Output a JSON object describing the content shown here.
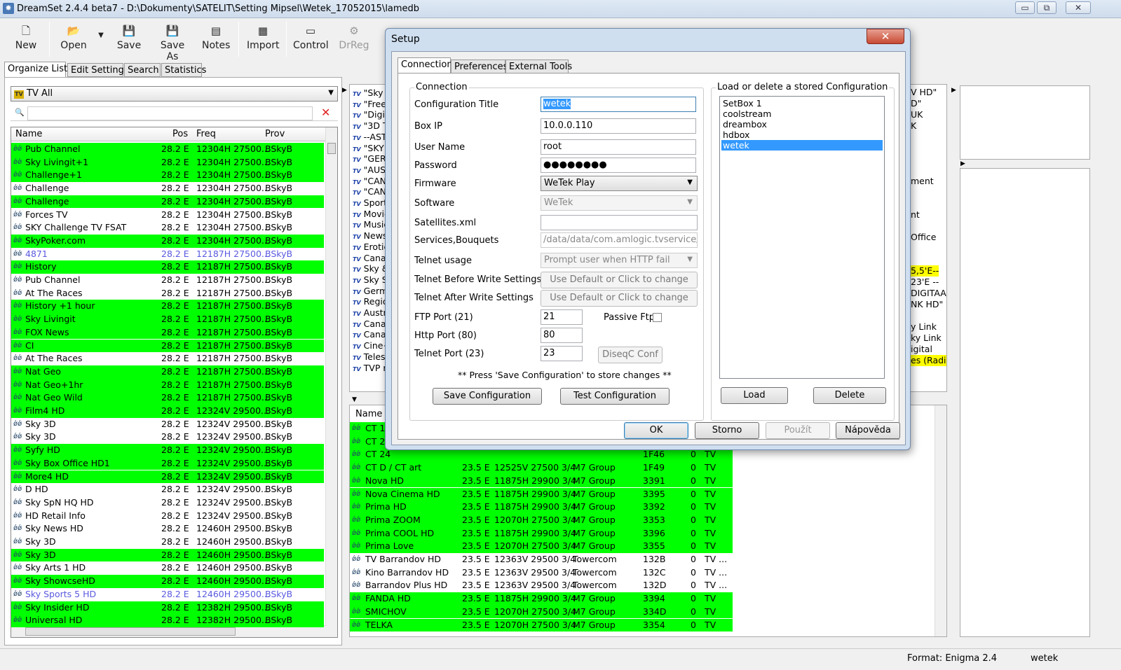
{
  "window": {
    "title": "DreamSet 2.4.4 beta7 - D:\\Dokumenty\\SATELIT\\Setting Mipsel\\Wetek_17052015\\lamedb",
    "min": "▭",
    "max": "⧉",
    "close": "✕"
  },
  "toolbar": {
    "new": "New",
    "open": "Open",
    "save": "Save",
    "save_as": "Save As",
    "notes": "Notes",
    "import": "Import",
    "control": "Control",
    "drreg": "DrReg"
  },
  "left_tabs": [
    "Organize Lists",
    "Edit Settings",
    "Search",
    "Statistics"
  ],
  "bouquet": "TV All",
  "list_headers": {
    "name": "Name",
    "pos": "Pos",
    "freq": "Freq",
    "prov": "Prov"
  },
  "channels": [
    {
      "name": "Pub Channel",
      "pos": "28.2 E",
      "freq": "12304H 27500...",
      "prov": "BSkyB",
      "style": "g"
    },
    {
      "name": "Sky Livingit+1",
      "pos": "28.2 E",
      "freq": "12304H 27500...",
      "prov": "BSkyB",
      "style": "g"
    },
    {
      "name": "Challenge+1",
      "pos": "28.2 E",
      "freq": "12304H 27500...",
      "prov": "BSkyB",
      "style": "g"
    },
    {
      "name": "Challenge",
      "pos": "28.2 E",
      "freq": "12304H 27500...",
      "prov": "BSkyB",
      "style": ""
    },
    {
      "name": "Challenge",
      "pos": "28.2 E",
      "freq": "12304H 27500...",
      "prov": "BSkyB",
      "style": "g"
    },
    {
      "name": "Forces TV",
      "pos": "28.2 E",
      "freq": "12304H 27500...",
      "prov": "BSkyB",
      "style": ""
    },
    {
      "name": "SKY Challenge TV FSAT",
      "pos": "28.2 E",
      "freq": "12304H 27500...",
      "prov": "BSkyB",
      "style": ""
    },
    {
      "name": "SkyPoker.com",
      "pos": "28.2 E",
      "freq": "12304H 27500...",
      "prov": "BSkyB",
      "style": "g"
    },
    {
      "name": "4871",
      "pos": "28.2 E",
      "freq": "12187H 27500...",
      "prov": "BSkyB",
      "style": "b"
    },
    {
      "name": "History",
      "pos": "28.2 E",
      "freq": "12187H 27500...",
      "prov": "BSkyB",
      "style": "g"
    },
    {
      "name": "Pub Channel",
      "pos": "28.2 E",
      "freq": "12187H 27500...",
      "prov": "BSkyB",
      "style": ""
    },
    {
      "name": "At The Races",
      "pos": "28.2 E",
      "freq": "12187H 27500...",
      "prov": "BSkyB",
      "style": ""
    },
    {
      "name": "History +1 hour",
      "pos": "28.2 E",
      "freq": "12187H 27500...",
      "prov": "BSkyB",
      "style": "g"
    },
    {
      "name": "Sky Livingit",
      "pos": "28.2 E",
      "freq": "12187H 27500...",
      "prov": "BSkyB",
      "style": "g"
    },
    {
      "name": "FOX News",
      "pos": "28.2 E",
      "freq": "12187H 27500...",
      "prov": "BSkyB",
      "style": "g"
    },
    {
      "name": "CI",
      "pos": "28.2 E",
      "freq": "12187H 27500...",
      "prov": "BSkyB",
      "style": "g"
    },
    {
      "name": "At The Races",
      "pos": "28.2 E",
      "freq": "12187H 27500...",
      "prov": "BSkyB",
      "style": ""
    },
    {
      "name": "Nat Geo",
      "pos": "28.2 E",
      "freq": "12187H 27500...",
      "prov": "BSkyB",
      "style": "g"
    },
    {
      "name": "Nat Geo+1hr",
      "pos": "28.2 E",
      "freq": "12187H 27500...",
      "prov": "BSkyB",
      "style": "g"
    },
    {
      "name": "Nat Geo Wild",
      "pos": "28.2 E",
      "freq": "12187H 27500...",
      "prov": "BSkyB",
      "style": "g"
    },
    {
      "name": "Film4 HD",
      "pos": "28.2 E",
      "freq": "12324V 29500...",
      "prov": "BSkyB",
      "style": "g"
    },
    {
      "name": "Sky 3D",
      "pos": "28.2 E",
      "freq": "12324V 29500...",
      "prov": "BSkyB",
      "style": ""
    },
    {
      "name": "Sky 3D",
      "pos": "28.2 E",
      "freq": "12324V 29500...",
      "prov": "BSkyB",
      "style": ""
    },
    {
      "name": "Syfy HD",
      "pos": "28.2 E",
      "freq": "12324V 29500...",
      "prov": "BSkyB",
      "style": "g"
    },
    {
      "name": "Sky Box Office HD1",
      "pos": "28.2 E",
      "freq": "12324V 29500...",
      "prov": "BSkyB",
      "style": "g"
    },
    {
      "name": "More4 HD",
      "pos": "28.2 E",
      "freq": "12324V 29500...",
      "prov": "BSkyB",
      "style": "g"
    },
    {
      "name": "D HD",
      "pos": "28.2 E",
      "freq": "12324V 29500...",
      "prov": "BSkyB",
      "style": ""
    },
    {
      "name": "Sky SpN HQ HD",
      "pos": "28.2 E",
      "freq": "12324V 29500...",
      "prov": "BSkyB",
      "style": ""
    },
    {
      "name": "HD Retail Info",
      "pos": "28.2 E",
      "freq": "12324V 29500...",
      "prov": "BSkyB",
      "style": ""
    },
    {
      "name": "Sky News HD",
      "pos": "28.2 E",
      "freq": "12460H 29500...",
      "prov": "BSkyB",
      "style": ""
    },
    {
      "name": "Sky 3D",
      "pos": "28.2 E",
      "freq": "12460H 29500...",
      "prov": "BSkyB",
      "style": ""
    },
    {
      "name": "Sky 3D",
      "pos": "28.2 E",
      "freq": "12460H 29500...",
      "prov": "BSkyB",
      "style": "g"
    },
    {
      "name": "Sky Arts 1 HD",
      "pos": "28.2 E",
      "freq": "12460H 29500...",
      "prov": "BSkyB",
      "style": ""
    },
    {
      "name": "Sky ShowcseHD",
      "pos": "28.2 E",
      "freq": "12460H 29500...",
      "prov": "BSkyB",
      "style": "g"
    },
    {
      "name": "Sky Sports 5 HD",
      "pos": "28.2 E",
      "freq": "12460H 29500...",
      "prov": "BSkyB",
      "style": "b"
    },
    {
      "name": "Sky Insider HD",
      "pos": "28.2 E",
      "freq": "12382H 29500...",
      "prov": "BSkyB",
      "style": "g"
    },
    {
      "name": "Universal HD",
      "pos": "28.2 E",
      "freq": "12382H 29500...",
      "prov": "BSkyB",
      "style": "g"
    }
  ],
  "bouquets_mid": [
    "\"Sky",
    "\"Free",
    "\"Digi",
    "\"3D T",
    "--AST",
    "\"SKY",
    "\"GER",
    "\"AUS",
    "\"CAN",
    "\"CAN",
    "Sport",
    "Movie",
    "Music",
    "News",
    "Erotic",
    "Canal",
    "Sky &",
    "Sky S",
    "Germ",
    "Regio",
    "Austri",
    "Canal",
    "Canal",
    "Cine+",
    "Teles",
    "TVP r"
  ],
  "right_fragments": [
    "V HD\"",
    "D\"",
    "UK",
    "K",
    "ment",
    "nt",
    "Office",
    "5,5'E--",
    "23'E --",
    "DIGITAA",
    "NK HD\"",
    "y Link",
    "ky Link",
    "igital",
    "es (Radic"
  ],
  "bottom_header": "Name",
  "bottom_rows": [
    {
      "name": "CT 1",
      "pos": "",
      "freq": "",
      "prov": "",
      "sid": "",
      "n": "",
      "type": "",
      "style": "g"
    },
    {
      "name": "CT 2",
      "pos": "",
      "freq": "",
      "prov": "",
      "sid": "",
      "n": "",
      "type": "",
      "style": "g"
    },
    {
      "name": "CT 24",
      "pos": "",
      "freq": "",
      "prov": "",
      "sid": "1F46",
      "n": "0",
      "type": "TV",
      "style": "g"
    },
    {
      "name": "CT D / CT art",
      "pos": "23.5 E",
      "freq": "12525V 27500 3/4",
      "prov": "M7 Group",
      "sid": "1F49",
      "n": "0",
      "type": "TV",
      "style": "g"
    },
    {
      "name": "Nova HD",
      "pos": "23.5 E",
      "freq": "11875H 29900 3/4",
      "prov": "M7 Group",
      "sid": "3391",
      "n": "0",
      "type": "TV",
      "style": "g"
    },
    {
      "name": "Nova Cinema HD",
      "pos": "23.5 E",
      "freq": "11875H 29900 3/4",
      "prov": "M7 Group",
      "sid": "3395",
      "n": "0",
      "type": "TV",
      "style": "g"
    },
    {
      "name": "Prima HD",
      "pos": "23.5 E",
      "freq": "11875H 29900 3/4",
      "prov": "M7 Group",
      "sid": "3392",
      "n": "0",
      "type": "TV",
      "style": "g"
    },
    {
      "name": "Prima ZOOM",
      "pos": "23.5 E",
      "freq": "12070H 27500 3/4",
      "prov": "M7 Group",
      "sid": "3353",
      "n": "0",
      "type": "TV",
      "style": "g"
    },
    {
      "name": "Prima COOL HD",
      "pos": "23.5 E",
      "freq": "11875H 29900 3/4",
      "prov": "M7 Group",
      "sid": "3396",
      "n": "0",
      "type": "TV",
      "style": "g"
    },
    {
      "name": "Prima Love",
      "pos": "23.5 E",
      "freq": "12070H 27500 3/4",
      "prov": "M7 Group",
      "sid": "3355",
      "n": "0",
      "type": "TV",
      "style": "g"
    },
    {
      "name": "TV Barrandov HD",
      "pos": "23.5 E",
      "freq": "12363V 29500 3/4",
      "prov": "Towercom",
      "sid": "132B",
      "n": "0",
      "type": "TV ...",
      "style": ""
    },
    {
      "name": "Kino Barrandov HD",
      "pos": "23.5 E",
      "freq": "12363V 29500 3/4",
      "prov": "Towercom",
      "sid": "132C",
      "n": "0",
      "type": "TV ...",
      "style": ""
    },
    {
      "name": "Barrandov Plus HD",
      "pos": "23.5 E",
      "freq": "12363V 29500 3/4",
      "prov": "Towercom",
      "sid": "132D",
      "n": "0",
      "type": "TV ...",
      "style": ""
    },
    {
      "name": "FANDA HD",
      "pos": "23.5 E",
      "freq": "11875H 29900 3/4",
      "prov": "M7 Group",
      "sid": "3394",
      "n": "0",
      "type": "TV",
      "style": "g"
    },
    {
      "name": "SMICHOV",
      "pos": "23.5 E",
      "freq": "12070H 27500 3/4",
      "prov": "M7 Group",
      "sid": "334D",
      "n": "0",
      "type": "TV",
      "style": "g"
    },
    {
      "name": "TELKA",
      "pos": "23.5 E",
      "freq": "12070H 27500 3/4",
      "prov": "M7 Group",
      "sid": "3354",
      "n": "0",
      "type": "TV",
      "style": "g"
    }
  ],
  "dialog": {
    "title": "Setup",
    "close": "✕",
    "tabs": [
      "Connection",
      "Preferences",
      "External Tools"
    ],
    "connection_group": "Connection",
    "labels": {
      "config_title": "Configuration Title",
      "box_ip": "Box IP",
      "user": "User Name",
      "password": "Password",
      "firmware": "Firmware",
      "software": "Software",
      "satxml": "Satellites.xml",
      "services": "Services,Bouquets",
      "telnet_usage": "Telnet usage",
      "telnet_before": "Telnet Before Write Settings",
      "telnet_after": "Telnet After Write Settings",
      "ftp": "FTP Port (21)",
      "http": "Http Port (80)",
      "telnet_port": "Telnet Port (23)",
      "passive": "Passive Ftp"
    },
    "values": {
      "config_title": "wetek",
      "box_ip": "10.0.0.110",
      "user": "root",
      "password": "●●●●●●●●",
      "firmware": "WeTek Play",
      "software": "WeTek",
      "satxml": "",
      "services": "/data/data/com.amlogic.tvservice/datal",
      "telnet_usage": "Prompt user when HTTP fail",
      "ftp": "21",
      "http": "80",
      "telnet_port": "23"
    },
    "use_default": "Use Default or Click to change",
    "diseqc": "DiseqC Conf",
    "note": "** Press 'Save Configuration' to store changes **",
    "save_cfg": "Save Configuration",
    "test_cfg": "Test Configuration",
    "stored_group": "Load or delete a stored Configuration",
    "stored": [
      "SetBox 1",
      "coolstream",
      "dreambox",
      "hdbox",
      "wetek"
    ],
    "load": "Load",
    "delete": "Delete",
    "ok": "OK",
    "storno": "Storno",
    "pouzit": "Použít",
    "napoveda": "Nápověda"
  },
  "status": {
    "format": "Format: Enigma 2.4",
    "user": "wetek"
  }
}
